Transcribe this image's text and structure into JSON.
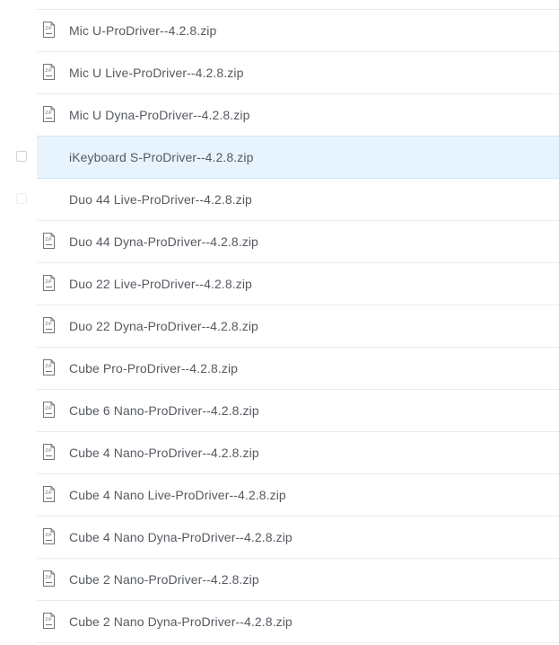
{
  "files": [
    {
      "name": "Mic U-ProDriver--4.2.8.zip",
      "icon": "zip-file-icon",
      "checkbox": "none"
    },
    {
      "name": "Mic U Live-ProDriver--4.2.8.zip",
      "icon": "zip-file-icon",
      "checkbox": "none"
    },
    {
      "name": "Mic U Dyna-ProDriver--4.2.8.zip",
      "icon": "zip-file-icon",
      "checkbox": "none"
    },
    {
      "name": "iKeyboard S-ProDriver--4.2.8.zip",
      "icon": "",
      "checkbox": "visible",
      "selected": true
    },
    {
      "name": "Duo 44 Live-ProDriver--4.2.8.zip",
      "icon": "",
      "checkbox": "faint"
    },
    {
      "name": "Duo 44 Dyna-ProDriver--4.2.8.zip",
      "icon": "zip-file-icon",
      "checkbox": "none"
    },
    {
      "name": "Duo 22 Live-ProDriver--4.2.8.zip",
      "icon": "zip-file-icon",
      "checkbox": "none"
    },
    {
      "name": "Duo 22 Dyna-ProDriver--4.2.8.zip",
      "icon": "zip-file-icon",
      "checkbox": "none"
    },
    {
      "name": "Cube Pro-ProDriver--4.2.8.zip",
      "icon": "zip-file-icon",
      "checkbox": "none"
    },
    {
      "name": "Cube 6 Nano-ProDriver--4.2.8.zip",
      "icon": "zip-file-icon",
      "checkbox": "none"
    },
    {
      "name": "Cube 4 Nano-ProDriver--4.2.8.zip",
      "icon": "zip-file-icon",
      "checkbox": "none"
    },
    {
      "name": "Cube 4 Nano Live-ProDriver--4.2.8.zip",
      "icon": "zip-file-icon",
      "checkbox": "none"
    },
    {
      "name": "Cube 4 Nano Dyna-ProDriver--4.2.8.zip",
      "icon": "zip-file-icon",
      "checkbox": "none"
    },
    {
      "name": "Cube 2 Nano-ProDriver--4.2.8.zip",
      "icon": "zip-file-icon",
      "checkbox": "none"
    },
    {
      "name": "Cube 2 Nano Dyna-ProDriver--4.2.8.zip",
      "icon": "zip-file-icon",
      "checkbox": "none"
    }
  ],
  "icon_label": "ZIP",
  "colors": {
    "text": "#555a60",
    "selected_bg": "#e8f4fd",
    "divider": "#ebebeb"
  }
}
